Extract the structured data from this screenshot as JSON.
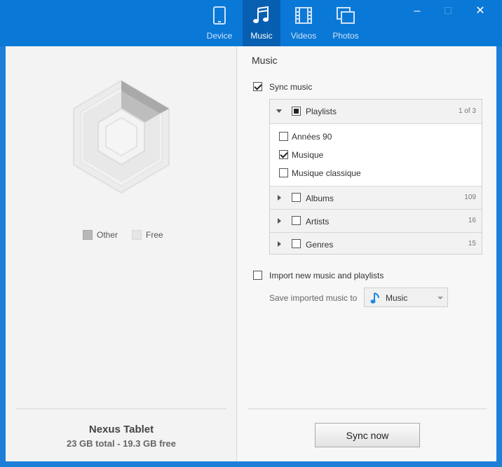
{
  "nav": {
    "tabs": [
      {
        "label": "Device",
        "icon": "tablet-icon",
        "active": false
      },
      {
        "label": "Music",
        "icon": "music-note-icon",
        "active": true
      },
      {
        "label": "Videos",
        "icon": "film-icon",
        "active": false
      },
      {
        "label": "Photos",
        "icon": "photos-icon",
        "active": false
      }
    ]
  },
  "window_controls": {
    "minimize": "–",
    "maximize": "□",
    "close": "✕"
  },
  "storage": {
    "legend": [
      {
        "label": "Other",
        "color": "#b8b8b8"
      },
      {
        "label": "Free",
        "color": "#e6e6e6"
      }
    ]
  },
  "device": {
    "name": "Nexus Tablet",
    "capacity": "23 GB total - 19.3 GB free"
  },
  "music": {
    "section_title": "Music",
    "sync_music": {
      "label": "Sync music",
      "checked": true
    },
    "playlists": {
      "label": "Playlists",
      "count": "1 of 3",
      "items": [
        {
          "label": "Années 90",
          "checked": false
        },
        {
          "label": "Musique",
          "checked": true
        },
        {
          "label": "Musique classique",
          "checked": false
        }
      ]
    },
    "albums": {
      "label": "Albums",
      "count": "109"
    },
    "artists": {
      "label": "Artists",
      "count": "16"
    },
    "genres": {
      "label": "Genres",
      "count": "15"
    },
    "import": {
      "label": "Import new music and playlists",
      "checked": false
    },
    "save_to_label": "Save imported music to",
    "save_to_value": "Music",
    "sync_button": "Sync now"
  },
  "colors": {
    "titlebar": "#0a78d7",
    "active_tab": "#075fb1",
    "music_note": "#1e88e5"
  }
}
